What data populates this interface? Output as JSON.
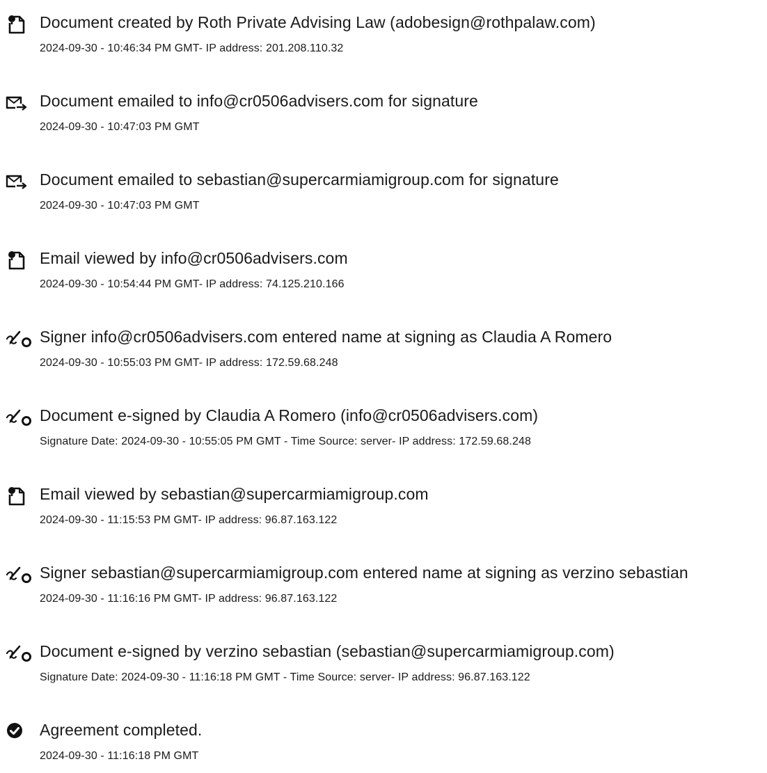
{
  "events": [
    {
      "icon": "document-viewed-icon",
      "title": "Document created by Roth Private Advising Law (adobesign@rothpalaw.com)",
      "meta": "2024-09-30 - 10:46:34 PM GMT- IP address: 201.208.110.32"
    },
    {
      "icon": "email-sent-icon",
      "title": "Document emailed to info@cr0506advisers.com for signature",
      "meta": "2024-09-30 - 10:47:03 PM GMT"
    },
    {
      "icon": "email-sent-icon",
      "title": "Document emailed to sebastian@supercarmiamigroup.com for signature",
      "meta": "2024-09-30 - 10:47:03 PM GMT"
    },
    {
      "icon": "document-viewed-icon",
      "title": "Email viewed by info@cr0506advisers.com",
      "meta": "2024-09-30 - 10:54:44 PM GMT- IP address: 74.125.210.166"
    },
    {
      "icon": "signature-pen-icon",
      "title": "Signer info@cr0506advisers.com entered name at signing as Claudia A Romero",
      "meta": "2024-09-30 - 10:55:03 PM GMT- IP address: 172.59.68.248"
    },
    {
      "icon": "signature-pen-icon",
      "title": "Document e-signed by Claudia A Romero (info@cr0506advisers.com)",
      "meta": "Signature Date: 2024-09-30 - 10:55:05 PM GMT - Time Source: server- IP address: 172.59.68.248"
    },
    {
      "icon": "document-viewed-icon",
      "title": "Email viewed by sebastian@supercarmiamigroup.com",
      "meta": "2024-09-30 - 11:15:53 PM GMT- IP address: 96.87.163.122"
    },
    {
      "icon": "signature-pen-icon",
      "title": "Signer sebastian@supercarmiamigroup.com entered name at signing as verzino sebastian",
      "meta": "2024-09-30 - 11:16:16 PM GMT- IP address: 96.87.163.122"
    },
    {
      "icon": "signature-pen-icon",
      "title": "Document e-signed by verzino sebastian (sebastian@supercarmiamigroup.com)",
      "meta": "Signature Date: 2024-09-30 - 11:16:18 PM GMT - Time Source: server- IP address: 96.87.163.122"
    },
    {
      "icon": "checkmark-circle-icon",
      "title": "Agreement completed.",
      "meta": "2024-09-30 - 11:16:18 PM GMT"
    }
  ]
}
